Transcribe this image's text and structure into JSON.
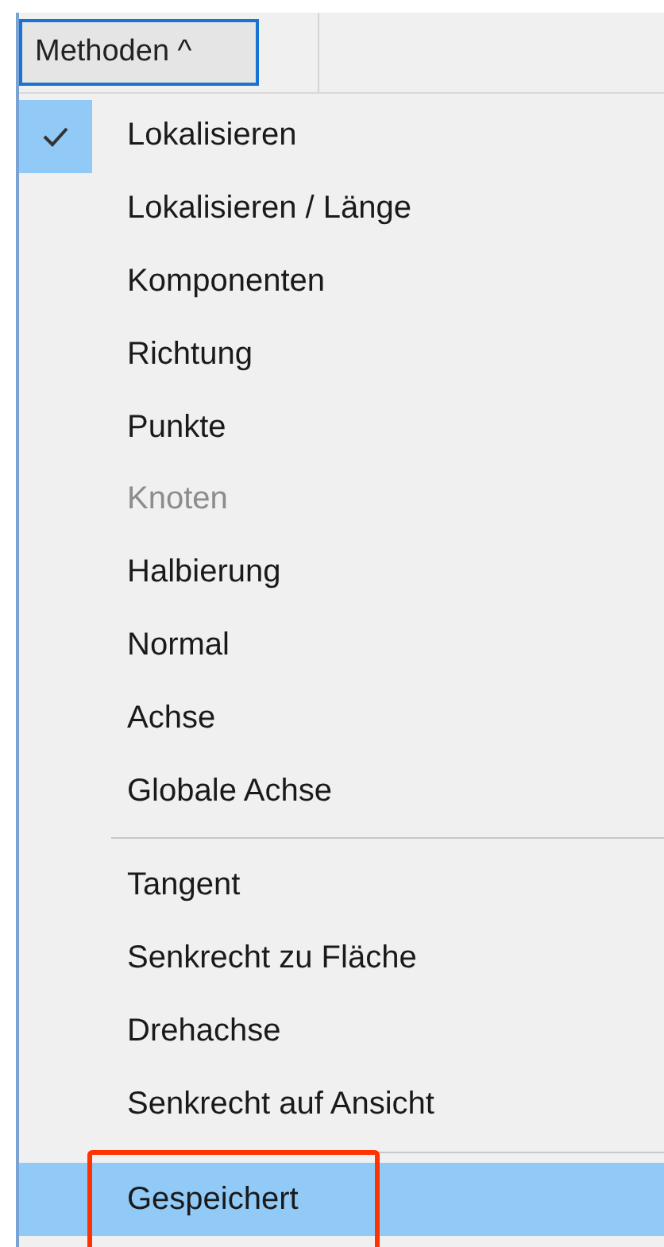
{
  "toolbar": {
    "button": {
      "label": "Methoden ^",
      "focused": true
    }
  },
  "menu": {
    "sections": [
      {
        "items": [
          {
            "label": "Lokalisieren",
            "checked": true,
            "disabled": false,
            "selected": false,
            "annotated": false
          },
          {
            "label": "Lokalisieren / Länge",
            "checked": false,
            "disabled": false,
            "selected": false,
            "annotated": false
          },
          {
            "label": "Komponenten",
            "checked": false,
            "disabled": false,
            "selected": false,
            "annotated": false
          },
          {
            "label": "Richtung",
            "checked": false,
            "disabled": false,
            "selected": false,
            "annotated": false
          },
          {
            "label": "Punkte",
            "checked": false,
            "disabled": false,
            "selected": false,
            "annotated": false
          },
          {
            "label": "Knoten",
            "checked": false,
            "disabled": true,
            "selected": false,
            "annotated": false
          },
          {
            "label": "Halbierung",
            "checked": false,
            "disabled": false,
            "selected": false,
            "annotated": false
          },
          {
            "label": "Normal",
            "checked": false,
            "disabled": false,
            "selected": false,
            "annotated": false
          },
          {
            "label": "Achse",
            "checked": false,
            "disabled": false,
            "selected": false,
            "annotated": false
          },
          {
            "label": "Globale Achse",
            "checked": false,
            "disabled": false,
            "selected": false,
            "annotated": false
          }
        ]
      },
      {
        "items": [
          {
            "label": "Tangent",
            "checked": false,
            "disabled": false,
            "selected": false,
            "annotated": false
          },
          {
            "label": "Senkrecht zu Fläche",
            "checked": false,
            "disabled": false,
            "selected": false,
            "annotated": false
          },
          {
            "label": "Drehachse",
            "checked": false,
            "disabled": false,
            "selected": false,
            "annotated": false
          },
          {
            "label": "Senkrecht auf Ansicht",
            "checked": false,
            "disabled": false,
            "selected": false,
            "annotated": false
          }
        ]
      },
      {
        "items": [
          {
            "label": "Gespeichert",
            "checked": false,
            "disabled": false,
            "selected": true,
            "annotated": true
          }
        ]
      }
    ]
  }
}
